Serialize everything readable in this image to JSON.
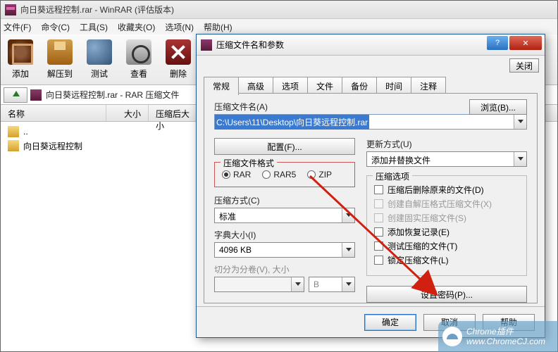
{
  "main": {
    "title": "向日葵远程控制.rar - WinRAR (评估版本)",
    "menu": [
      "文件(F)",
      "命令(C)",
      "工具(S)",
      "收藏夹(O)",
      "选项(N)",
      "帮助(H)"
    ],
    "tools": [
      "添加",
      "解压到",
      "测试",
      "查看",
      "删除"
    ],
    "path": "向日葵远程控制.rar - RAR 压缩文件",
    "cols": {
      "name": "名称",
      "size": "大小",
      "packed": "压缩后大小"
    },
    "files": [
      {
        "name": ".."
      },
      {
        "name": "向日葵远程控制"
      }
    ]
  },
  "dialog": {
    "title": "压缩文件名和参数",
    "close_label": "关闭",
    "tabs": [
      "常规",
      "高级",
      "选项",
      "文件",
      "备份",
      "时间",
      "注释"
    ],
    "filename_label": "压缩文件名(A)",
    "browse": "浏览(B)...",
    "filename_value": "C:\\Users\\11\\Desktop\\向日葵远程控制.rar",
    "config_btn": "配置(F)...",
    "update_label": "更新方式(U)",
    "update_value": "添加并替换文件",
    "format_label": "压缩文件格式",
    "formats": {
      "rar": "RAR",
      "rar5": "RAR5",
      "zip": "ZIP"
    },
    "options_label": "压缩选项",
    "opts": {
      "delete": "压缩后删除原来的文件(D)",
      "sfx": "创建自解压格式压缩文件(X)",
      "solid": "创建固实压缩文件(S)",
      "recovery": "添加恢复记录(E)",
      "test": "测试压缩的文件(T)",
      "lock": "锁定压缩文件(L)"
    },
    "method_label": "压缩方式(C)",
    "method_value": "标准",
    "dict_label": "字典大小(I)",
    "dict_value": "4096 KB",
    "split_label": "切分为分卷(V), 大小",
    "split_unit": "B",
    "password_btn": "设置密码(P)...",
    "ok": "确定",
    "cancel": "取消",
    "help": "帮助"
  },
  "watermark": {
    "line1": "Chrome插件",
    "line2": "www.ChromeCJ.com"
  }
}
